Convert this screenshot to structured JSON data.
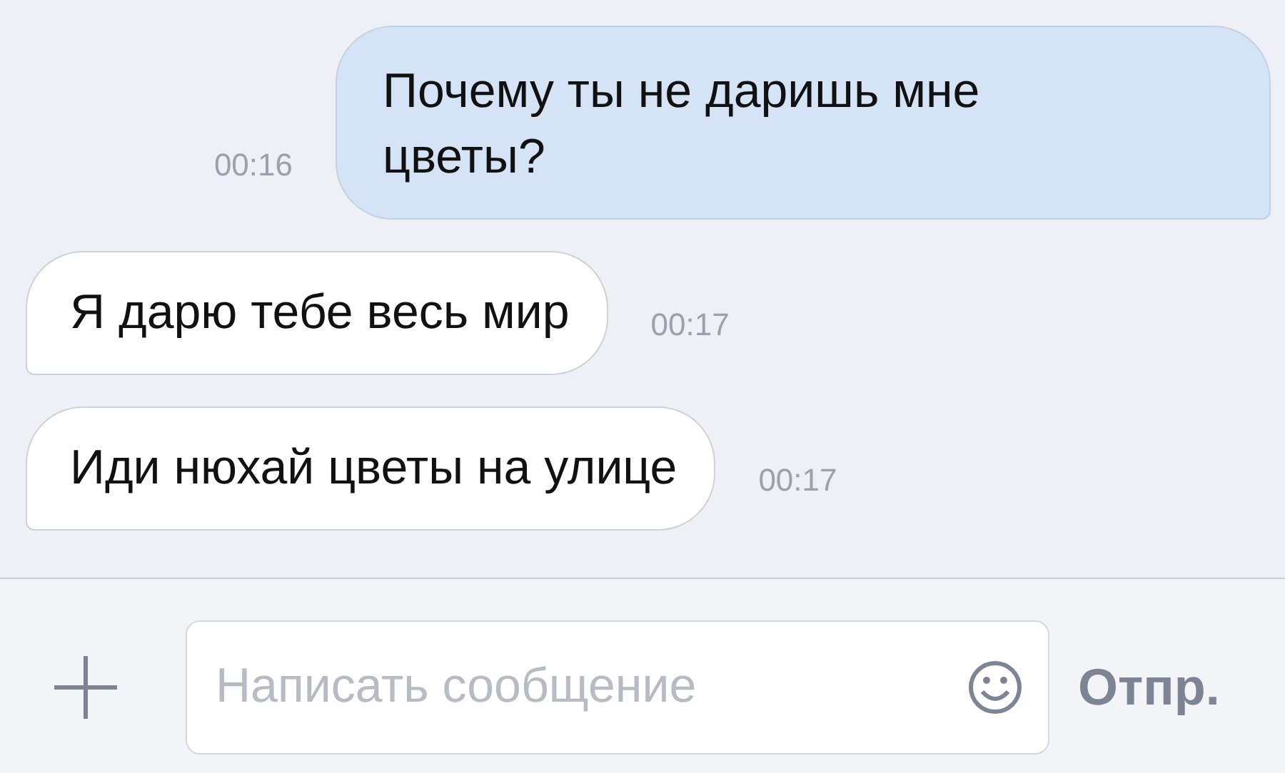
{
  "messages": [
    {
      "kind": "outgoing",
      "text": "Почему ты не даришь мне цветы?",
      "time": "00:16"
    },
    {
      "kind": "incoming",
      "text": "Я дарю тебе весь мир",
      "time": "00:17"
    },
    {
      "kind": "incoming",
      "text": "Иди нюхай цветы на улице",
      "time": "00:17"
    }
  ],
  "composer": {
    "placeholder": "Написать сообщение",
    "send": "Отпр."
  }
}
